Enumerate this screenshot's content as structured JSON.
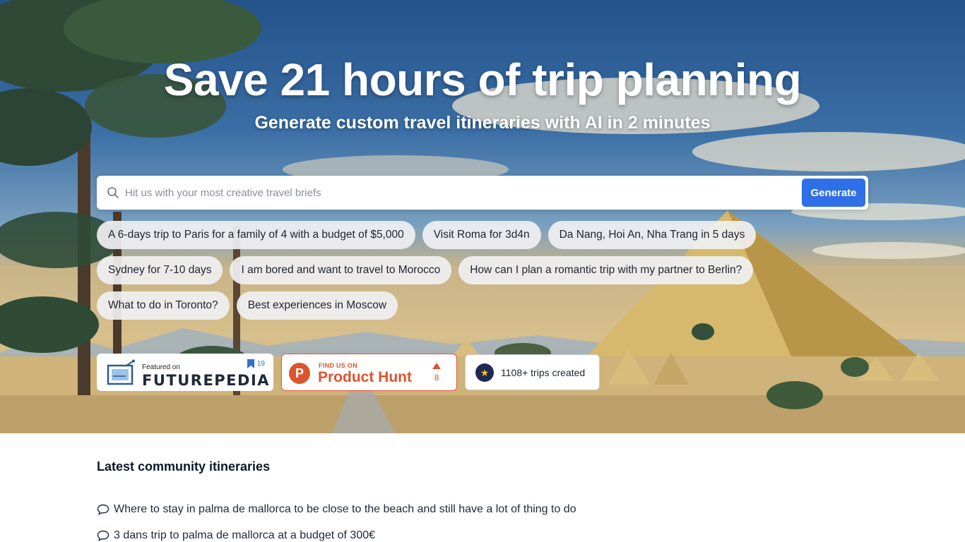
{
  "hero": {
    "title": "Save 21 hours of trip planning",
    "subtitle": "Generate custom travel itineraries with AI in 2 minutes"
  },
  "search": {
    "placeholder": "Hit us with your most creative travel briefs",
    "value": "",
    "icon": "search-icon",
    "button_label": "Generate"
  },
  "suggestions": [
    [
      "A 6-days trip to Paris for a family of 4 with a budget of $5,000",
      "Visit Roma for 3d4n",
      "Da Nang, Hoi An, Nha Trang in 5 days"
    ],
    [
      "Sydney for 7-10 days",
      "I am bored and want to travel to Morocco",
      "How can I plan a romantic trip with my partner to Berlin?"
    ],
    [
      "What to do in Toronto?",
      "Best experiences in Moscow"
    ]
  ],
  "badges": {
    "futurepedia": {
      "small": "Featured on",
      "big": "FUTUREPEDIA",
      "count": "19"
    },
    "producthunt": {
      "small": "FIND US ON",
      "big": "Product Hunt",
      "votes": "8",
      "logo_letter": "P"
    },
    "trips": {
      "text": "1108+ trips created",
      "icon": "star-icon"
    }
  },
  "community": {
    "title": "Latest community itineraries",
    "items": [
      "Where to stay in palma de mallorca to be close to the beach and still have a lot of thing to do",
      "3 dans trip to palma de mallorca at a budget of 300€"
    ]
  },
  "colors": {
    "accent": "#2f6fe8",
    "producthunt": "#da552f",
    "text_dark": "#0f172a"
  }
}
